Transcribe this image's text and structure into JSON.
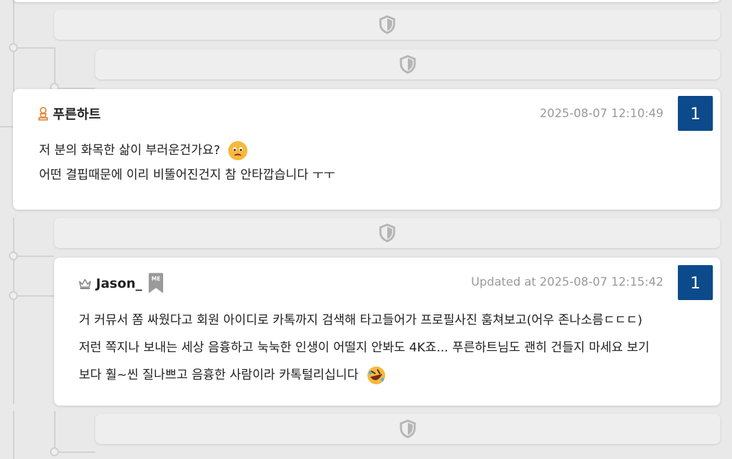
{
  "comments": [
    {
      "author": "푸른하트",
      "timestamp": "2025-08-07 12:10:49",
      "votes": "1",
      "lines": [
        "저 분의 화목한 삶이 부러운건가요?",
        "어떤 결핍때문에 이리 비뚤어진건지 참 안타깝습니다 ㅜㅜ"
      ],
      "rank_icon": "person-rank-icon",
      "emoji": "sad-face-emoji"
    },
    {
      "author": "Jason_",
      "me_badge": "ME",
      "timestamp": "Updated at 2025-08-07 12:15:42",
      "votes": "1",
      "lines": [
        "거 커뮤서 쫌 싸웠다고 회원 아이디로 카톡까지 검색해 타고들어가 프로필사진 훔쳐보고(어우 존나소름ㄷㄷㄷ)",
        "저런 쪽지나 보내는 세상 음흉하고 눅눅한 인생이 어떨지 안봐도 4K죠... 푸른하트님도 괜히 건들지 마세요 보기",
        "보다 훨~씬 질나쁘고 음흉한 사람이라 카톡털리십니다"
      ],
      "rank_icon": "crown-rank-icon",
      "emoji": "rolling-laughing-emoji"
    }
  ],
  "hidden_icon": "shield-icon",
  "colors": {
    "vote_badge": "#0c4a8c",
    "timestamp": "#9a9a9a",
    "page_bg": "#e9e9e9"
  }
}
